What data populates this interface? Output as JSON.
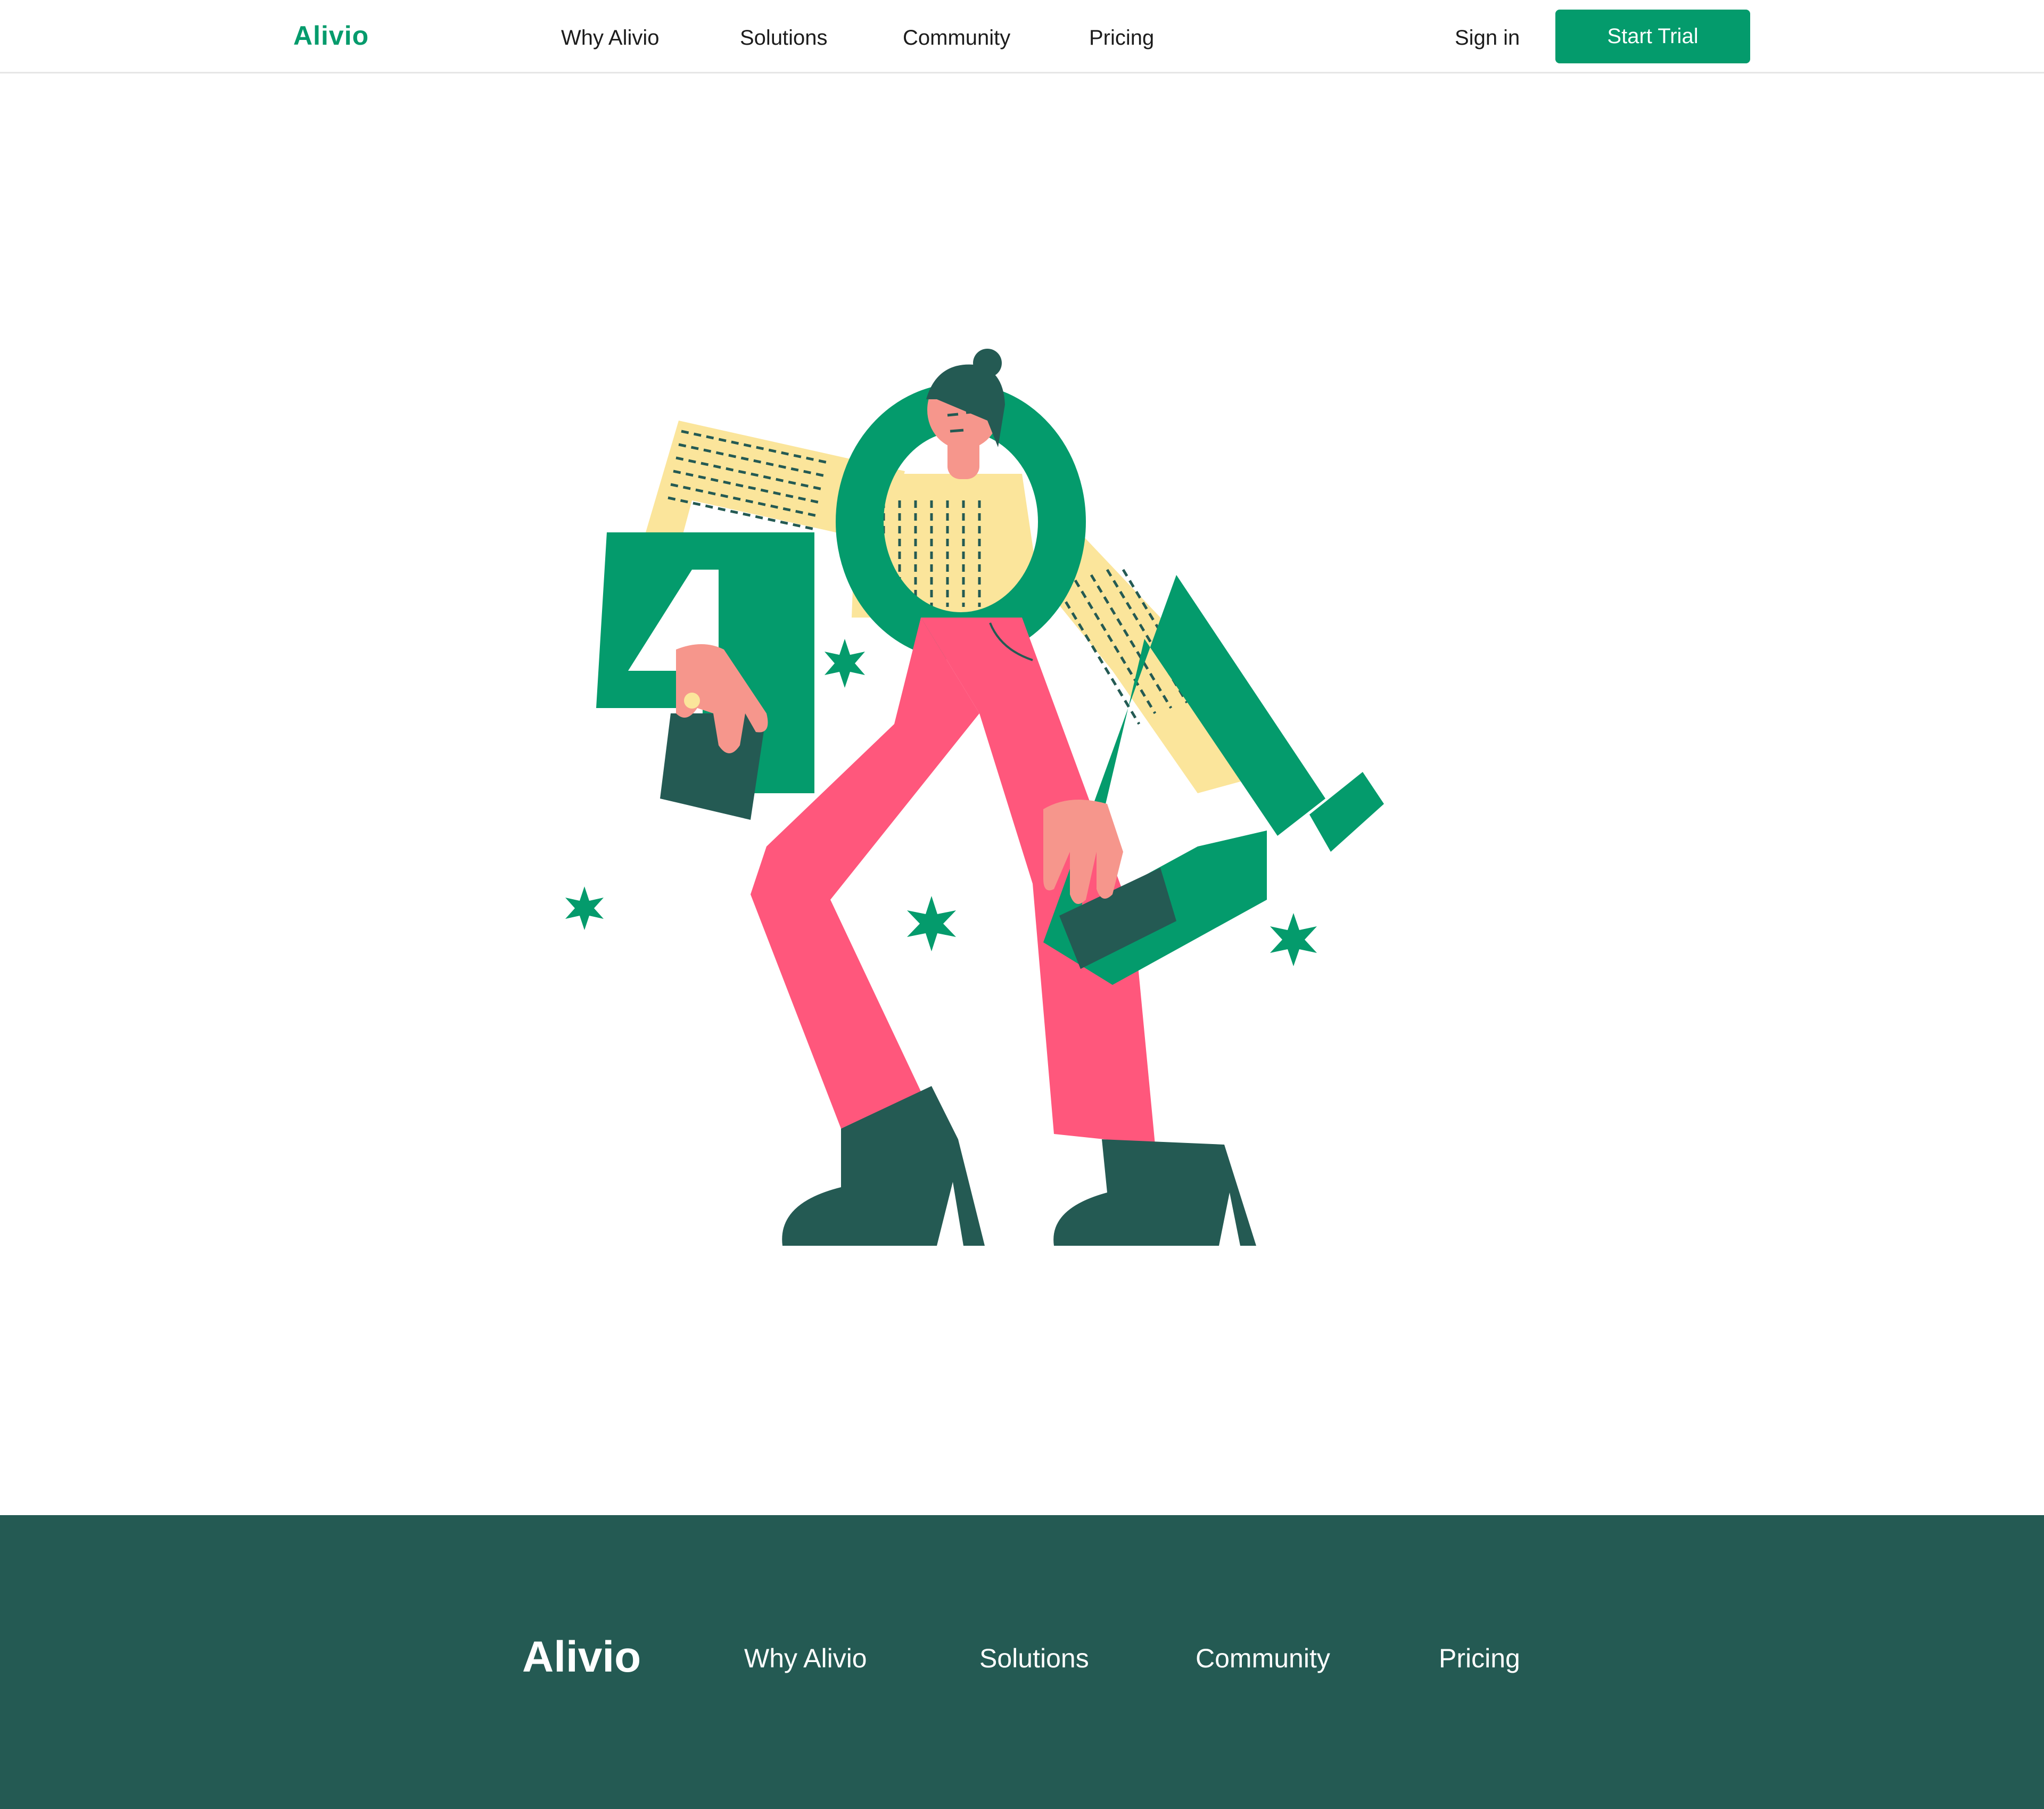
{
  "header": {
    "brand": "Alivio",
    "nav": [
      "Why Alivio",
      "Solutions",
      "Community",
      "Pricing"
    ],
    "sign_in": "Sign in",
    "cta": "Start Trial"
  },
  "illustration": {
    "numerals": [
      "4",
      "0",
      "4"
    ]
  },
  "footer": {
    "brand": "Alivio",
    "nav": [
      "Why Alivio",
      "Solutions",
      "Community",
      "Pricing"
    ]
  },
  "colors": {
    "brand_green": "#049b6c",
    "dark_green": "#245a53",
    "pink": "#ff577c",
    "yellow": "#fbe59b",
    "skin": "#f6968c"
  }
}
